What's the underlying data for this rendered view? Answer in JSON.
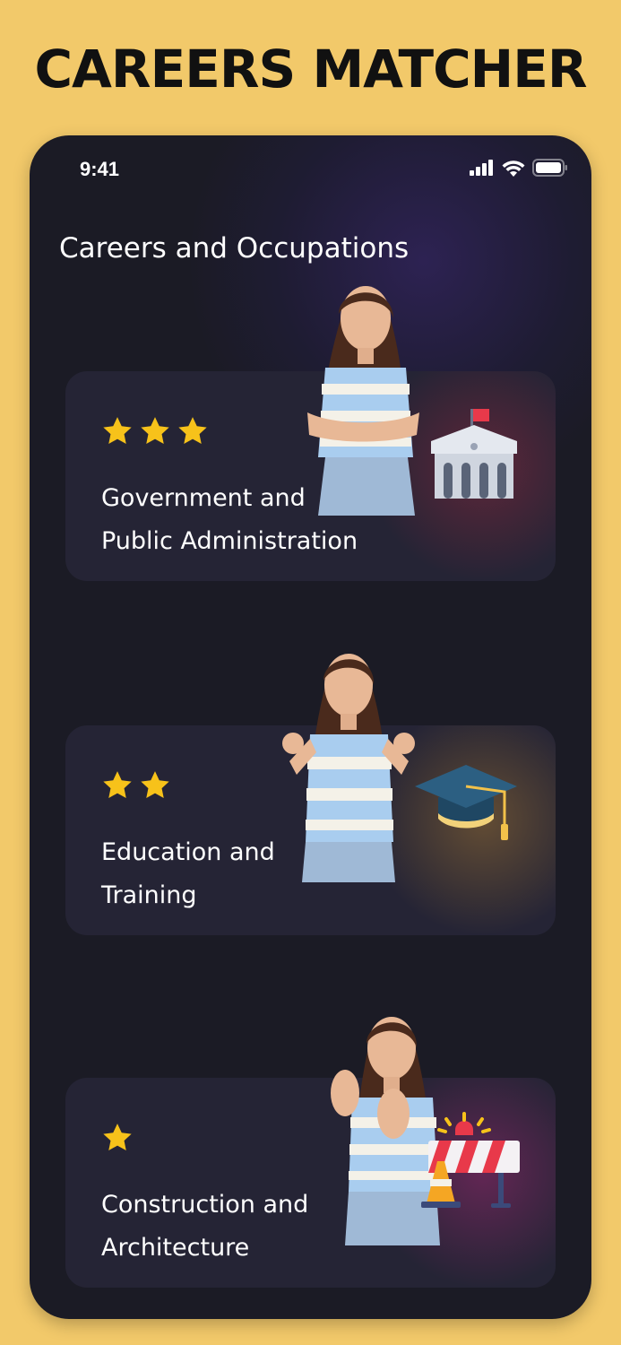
{
  "promo": {
    "headline": "CAREERS MATCHER"
  },
  "status_bar": {
    "time": "9:41",
    "icons": [
      "cellular-signal-icon",
      "wifi-icon",
      "battery-icon"
    ]
  },
  "screen": {
    "title": "Careers and Occupations"
  },
  "cards": [
    {
      "rating": 3,
      "title_line1": "Government and",
      "title_line2": "Public Administration",
      "icon": "government-building-icon",
      "glow_color": "#8c283c"
    },
    {
      "rating": 2,
      "title_line1": "Education and",
      "title_line2": "Training",
      "icon": "graduation-cap-icon",
      "glow_color": "#966e32"
    },
    {
      "rating": 1,
      "title_line1": "Construction and",
      "title_line2": "Architecture",
      "icon": "road-barrier-icon",
      "glow_color": "#96286e"
    }
  ],
  "colors": {
    "background": "#f2c96a",
    "phone": "#1b1b25",
    "card": "#252435",
    "star": "#f7c21a",
    "text": "#ffffff"
  }
}
